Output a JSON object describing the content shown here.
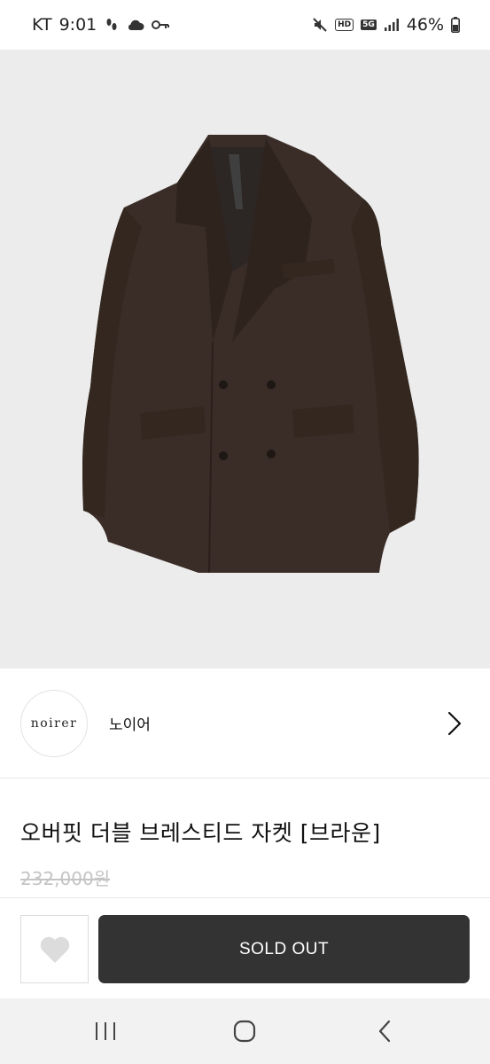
{
  "status_bar": {
    "carrier": "KT",
    "time": "9:01",
    "battery": "46%",
    "left_icons": [
      "footsteps-icon",
      "cloud-icon",
      "key-icon"
    ],
    "right_icons": [
      "mute-icon",
      "hd-icon",
      "5g-icon",
      "signal-icon",
      "battery-icon"
    ],
    "hd_label": "HD",
    "fiveg_label": "5G"
  },
  "product_image": {
    "subject": "double-breasted brown jacket",
    "background_color": "#ececec",
    "jacket_color": "#3a2d28"
  },
  "seller": {
    "logo_text": "noirer",
    "name": "노이어"
  },
  "product": {
    "title": "오버핏 더블 브레스티드 자켓 [브라운]",
    "price": "232,000원"
  },
  "actions": {
    "soldout_label": "SOLD OUT",
    "soldout_color": "#333333"
  },
  "nav": {
    "icons": [
      "recent-apps-icon",
      "home-icon",
      "back-icon"
    ]
  }
}
